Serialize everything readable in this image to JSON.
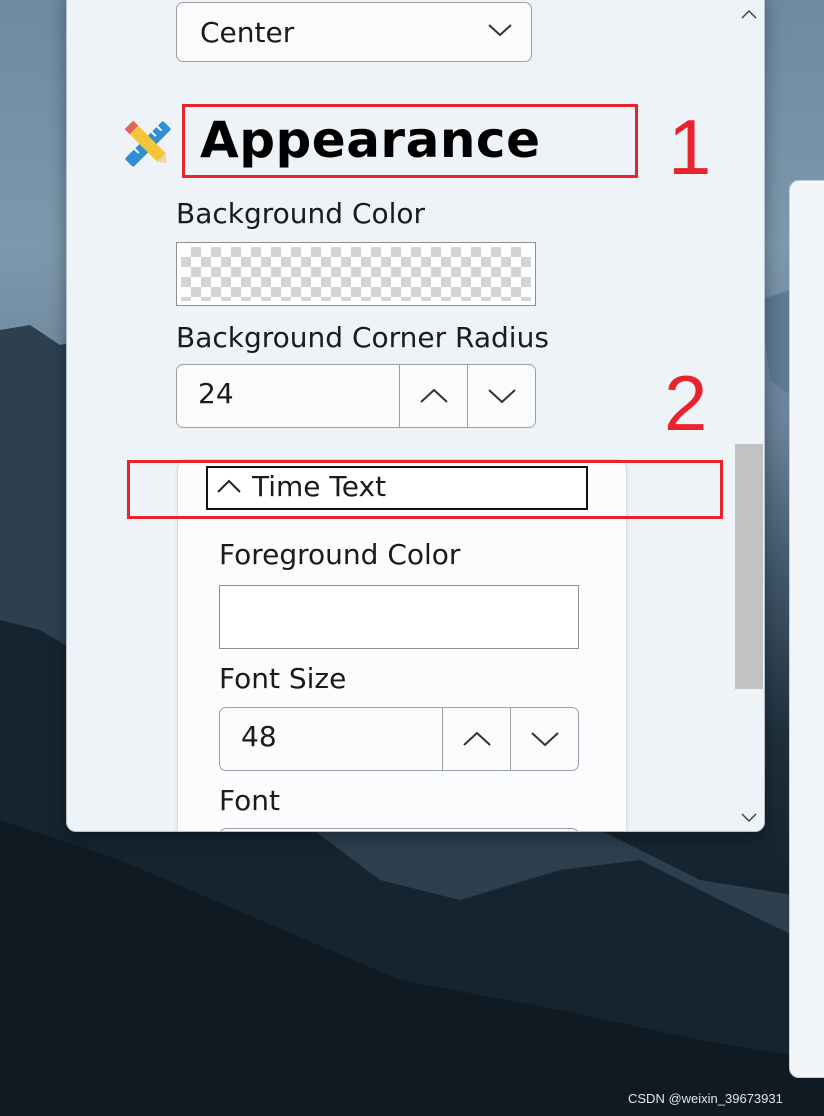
{
  "panel": {
    "alignment_value": "Center",
    "section_title": "Appearance",
    "background_color_label": "Background Color",
    "corner_radius_label": "Background Corner Radius",
    "corner_radius_value": "24",
    "time_text": {
      "header": "Time Text",
      "foreground_color_label": "Foreground Color",
      "font_size_label": "Font Size",
      "font_size_value": "48",
      "font_label": "Font"
    }
  },
  "annotations": {
    "label_1": "1",
    "label_2": "2",
    "color": "#e8232e"
  },
  "watermark": "CSDN @weixin_39673931",
  "icons": [
    "pencil-ruler-icon",
    "chevron-down-icon",
    "chevron-up-icon",
    "scroll-up-arrow-icon",
    "scroll-down-arrow-icon"
  ]
}
